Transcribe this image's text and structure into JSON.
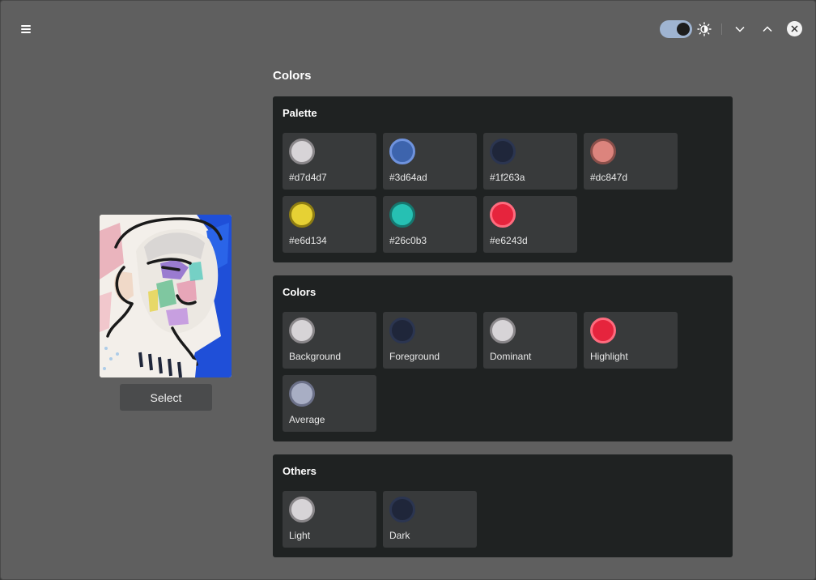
{
  "header": {
    "menu_icon": "hamburger-menu-icon",
    "theme_toggle_on": true,
    "theme_icon": "sun-contrast-icon",
    "buttons": [
      "chevron-down-icon",
      "chevron-up-icon",
      "close-icon"
    ]
  },
  "left": {
    "image_alt": "portrait-artwork",
    "select_label": "Select"
  },
  "main": {
    "title": "Colors",
    "palette": {
      "title": "Palette",
      "items": [
        {
          "label": "#d7d4d7",
          "color": "#d7d4d7",
          "ring": "#8a878a"
        },
        {
          "label": "#3d64ad",
          "color": "#3d64ad",
          "ring": "#6f93de"
        },
        {
          "label": "#1f263a",
          "color": "#1f263a",
          "ring": "#2b3550"
        },
        {
          "label": "#dc847d",
          "color": "#dc847d",
          "ring": "#8a4f4a"
        },
        {
          "label": "#e6d134",
          "color": "#e6d134",
          "ring": "#8f7e12"
        },
        {
          "label": "#26c0b3",
          "color": "#26c0b3",
          "ring": "#16776f"
        },
        {
          "label": "#e6243d",
          "color": "#e6243d",
          "ring": "#ff6b7e"
        }
      ]
    },
    "colors": {
      "title": "Colors",
      "items": [
        {
          "label": "Background",
          "color": "#d7d4d7",
          "ring": "#8a878a"
        },
        {
          "label": "Foreground",
          "color": "#1f263a",
          "ring": "#2b3550"
        },
        {
          "label": "Dominant",
          "color": "#d7d4d7",
          "ring": "#8a878a"
        },
        {
          "label": "Highlight",
          "color": "#e6243d",
          "ring": "#ff6b7e"
        },
        {
          "label": "Average",
          "color": "#a8aec4",
          "ring": "#6b7088"
        }
      ]
    },
    "others": {
      "title": "Others",
      "items": [
        {
          "label": "Light",
          "color": "#d7d4d7",
          "ring": "#8a878a"
        },
        {
          "label": "Dark",
          "color": "#1f263a",
          "ring": "#2b3550"
        }
      ]
    }
  }
}
